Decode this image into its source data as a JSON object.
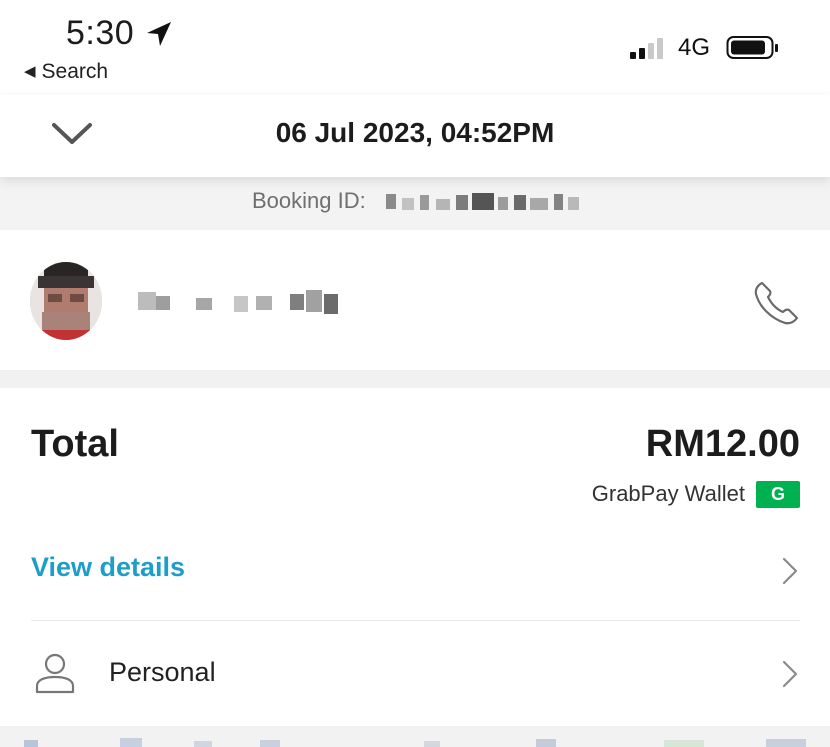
{
  "status_bar": {
    "time": "5:30",
    "back_label": "Search",
    "network": "4G",
    "icons": [
      "location-arrow-icon",
      "signal-bars-icon",
      "battery-icon"
    ]
  },
  "header": {
    "title": "06 Jul 2023, 04:52PM",
    "icon": "chevron-down-icon"
  },
  "booking": {
    "label": "Booking ID:"
  },
  "driver": {
    "icon": "phone-icon"
  },
  "payment": {
    "total_label": "Total",
    "amount": "RM12.00",
    "method": "GrabPay Wallet",
    "method_badge": "G",
    "badge_color": "#00b14f"
  },
  "actions": {
    "view_details": "View details",
    "view_details_color": "#1d9ec9",
    "profile_label": "Personal",
    "profile_icon": "person-icon"
  }
}
